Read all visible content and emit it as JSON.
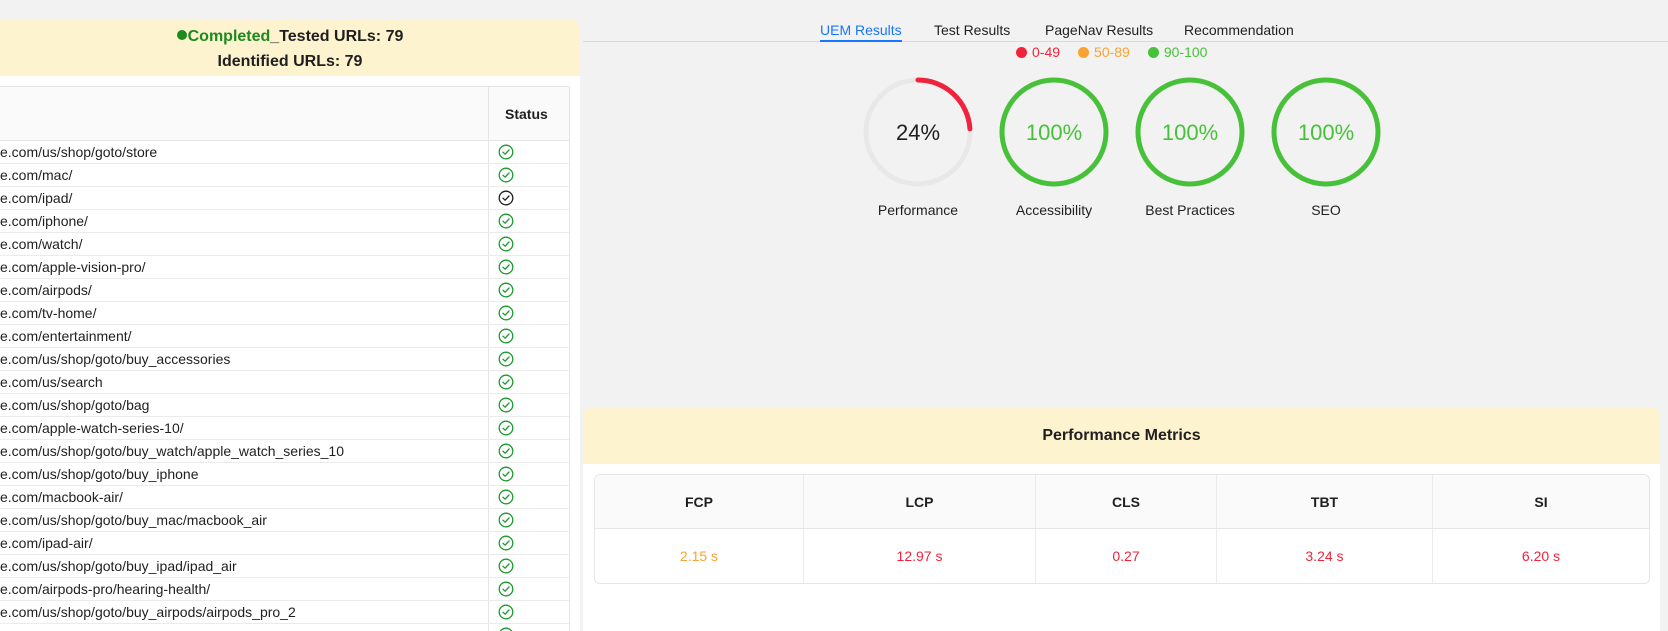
{
  "summary": {
    "status_word": "Completed",
    "tested_text": "_Tested URLs: 79",
    "identified_text": "Identified URLs: 79"
  },
  "url_table": {
    "status_header": "Status",
    "rows": [
      {
        "url": "e.com/us/shop/goto/store",
        "status": "success"
      },
      {
        "url": "e.com/mac/",
        "status": "success"
      },
      {
        "url": "e.com/ipad/",
        "status": "neutral"
      },
      {
        "url": "e.com/iphone/",
        "status": "success"
      },
      {
        "url": "e.com/watch/",
        "status": "success"
      },
      {
        "url": "e.com/apple-vision-pro/",
        "status": "success"
      },
      {
        "url": "e.com/airpods/",
        "status": "success"
      },
      {
        "url": "e.com/tv-home/",
        "status": "success"
      },
      {
        "url": "e.com/entertainment/",
        "status": "success"
      },
      {
        "url": "e.com/us/shop/goto/buy_accessories",
        "status": "success"
      },
      {
        "url": "e.com/us/search",
        "status": "success"
      },
      {
        "url": "e.com/us/shop/goto/bag",
        "status": "success"
      },
      {
        "url": "e.com/apple-watch-series-10/",
        "status": "success"
      },
      {
        "url": "e.com/us/shop/goto/buy_watch/apple_watch_series_10",
        "status": "success"
      },
      {
        "url": "e.com/us/shop/goto/buy_iphone",
        "status": "success"
      },
      {
        "url": "e.com/macbook-air/",
        "status": "success"
      },
      {
        "url": "e.com/us/shop/goto/buy_mac/macbook_air",
        "status": "success"
      },
      {
        "url": "e.com/ipad-air/",
        "status": "success"
      },
      {
        "url": "e.com/us/shop/goto/buy_ipad/ipad_air",
        "status": "success"
      },
      {
        "url": "e.com/airpods-pro/hearing-health/",
        "status": "success"
      },
      {
        "url": "e.com/us/shop/goto/buy_airpods/airpods_pro_2",
        "status": "success"
      },
      {
        "url": "",
        "status": "success"
      }
    ]
  },
  "tabs": [
    {
      "label": "UEM Results",
      "active": true
    },
    {
      "label": "Test Results",
      "active": false
    },
    {
      "label": "PageNav Results",
      "active": false
    },
    {
      "label": "Recommendation",
      "active": false
    }
  ],
  "legend": [
    {
      "label": "0-49",
      "color": "#f0233c"
    },
    {
      "label": "50-89",
      "color": "#faa331"
    },
    {
      "label": "90-100",
      "color": "#48c13a"
    }
  ],
  "scores": [
    {
      "label": "Performance",
      "value": 24,
      "display": "24%",
      "color": "#f0233c",
      "text_color": "#1f1f1f"
    },
    {
      "label": "Accessibility",
      "value": 100,
      "display": "100%",
      "color": "#48c13a",
      "text_color": "#48c13a"
    },
    {
      "label": "Best Practices",
      "value": 100,
      "display": "100%",
      "color": "#48c13a",
      "text_color": "#48c13a"
    },
    {
      "label": "SEO",
      "value": 100,
      "display": "100%",
      "color": "#48c13a",
      "text_color": "#48c13a"
    }
  ],
  "metrics": {
    "title": "Performance Metrics",
    "headers": [
      "FCP",
      "LCP",
      "CLS",
      "TBT",
      "SI"
    ],
    "values": [
      {
        "text": "2.15 s",
        "color": "#faa331"
      },
      {
        "text": "12.97 s",
        "color": "#f0233c"
      },
      {
        "text": "0.27",
        "color": "#f0233c"
      },
      {
        "text": "3.24 s",
        "color": "#f0233c"
      },
      {
        "text": "6.20 s",
        "color": "#f0233c"
      }
    ]
  },
  "colors": {
    "success": "#1c9a2e",
    "neutral": "#1f1f1f",
    "track": "#e8e8e8",
    "accent": "#1677ff"
  }
}
